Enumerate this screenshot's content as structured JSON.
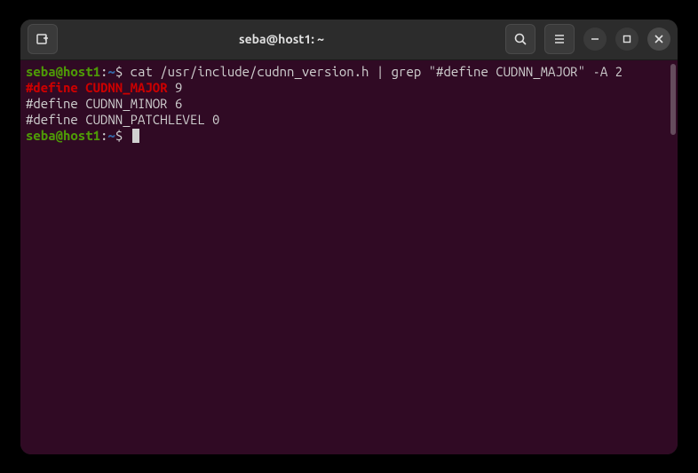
{
  "window": {
    "title": "seba@host1: ~"
  },
  "prompt": {
    "user_host": "seba@host1",
    "colon": ":",
    "path": "~",
    "dollar": "$ "
  },
  "lines": {
    "command": "cat /usr/include/cudnn_version.h | grep \"#define CUDNN_MAJOR\" -A 2",
    "match_prefix": "#define CUDNN_MAJOR",
    "match_rest": " 9",
    "line2": "#define CUDNN_MINOR 6",
    "line3": "#define CUDNN_PATCHLEVEL 0"
  }
}
